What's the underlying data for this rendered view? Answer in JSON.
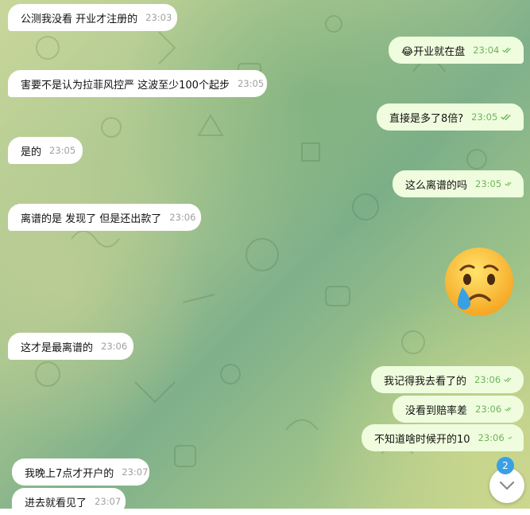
{
  "messages": [
    {
      "text": "公测我没看 开业才注册的",
      "time": "23:03",
      "dir": "in"
    },
    {
      "text": "开业就在盘",
      "emoji": "😂",
      "time": "23:04",
      "dir": "out"
    },
    {
      "text": "害要不是认为拉菲风控严 这波至少100个起步",
      "time": "23:05",
      "dir": "in"
    },
    {
      "text": "直接是多了8倍?",
      "time": "23:05",
      "dir": "out"
    },
    {
      "text": "是的",
      "time": "23:05",
      "dir": "in"
    },
    {
      "text": "这么离谱的吗",
      "time": "23:05",
      "dir": "out"
    },
    {
      "text": "离谱的是 发现了 但是还出款了",
      "time": "23:06",
      "dir": "in"
    },
    {
      "sticker": "crying-face",
      "dir": "out"
    },
    {
      "text": "这才是最离谱的",
      "time": "23:06",
      "dir": "in"
    },
    {
      "text": "我记得我去看了的",
      "time": "23:06",
      "dir": "out"
    },
    {
      "text": "没看到赔率差",
      "time": "23:06",
      "dir": "out"
    },
    {
      "text": "不知道啥时候开的10",
      "time": "23:06",
      "dir": "out"
    },
    {
      "text": "我晚上7点才开户的",
      "time": "23:07",
      "dir": "in"
    },
    {
      "text": "进去就看见了",
      "time": "23:07",
      "dir": "in"
    }
  ],
  "scroll": {
    "unread_count": "2",
    "icon": "chevron-down-icon"
  },
  "colors": {
    "outgoing": "#effdde",
    "incoming": "#ffffff",
    "check": "#5fb04d",
    "badge": "#3aa0e4"
  }
}
